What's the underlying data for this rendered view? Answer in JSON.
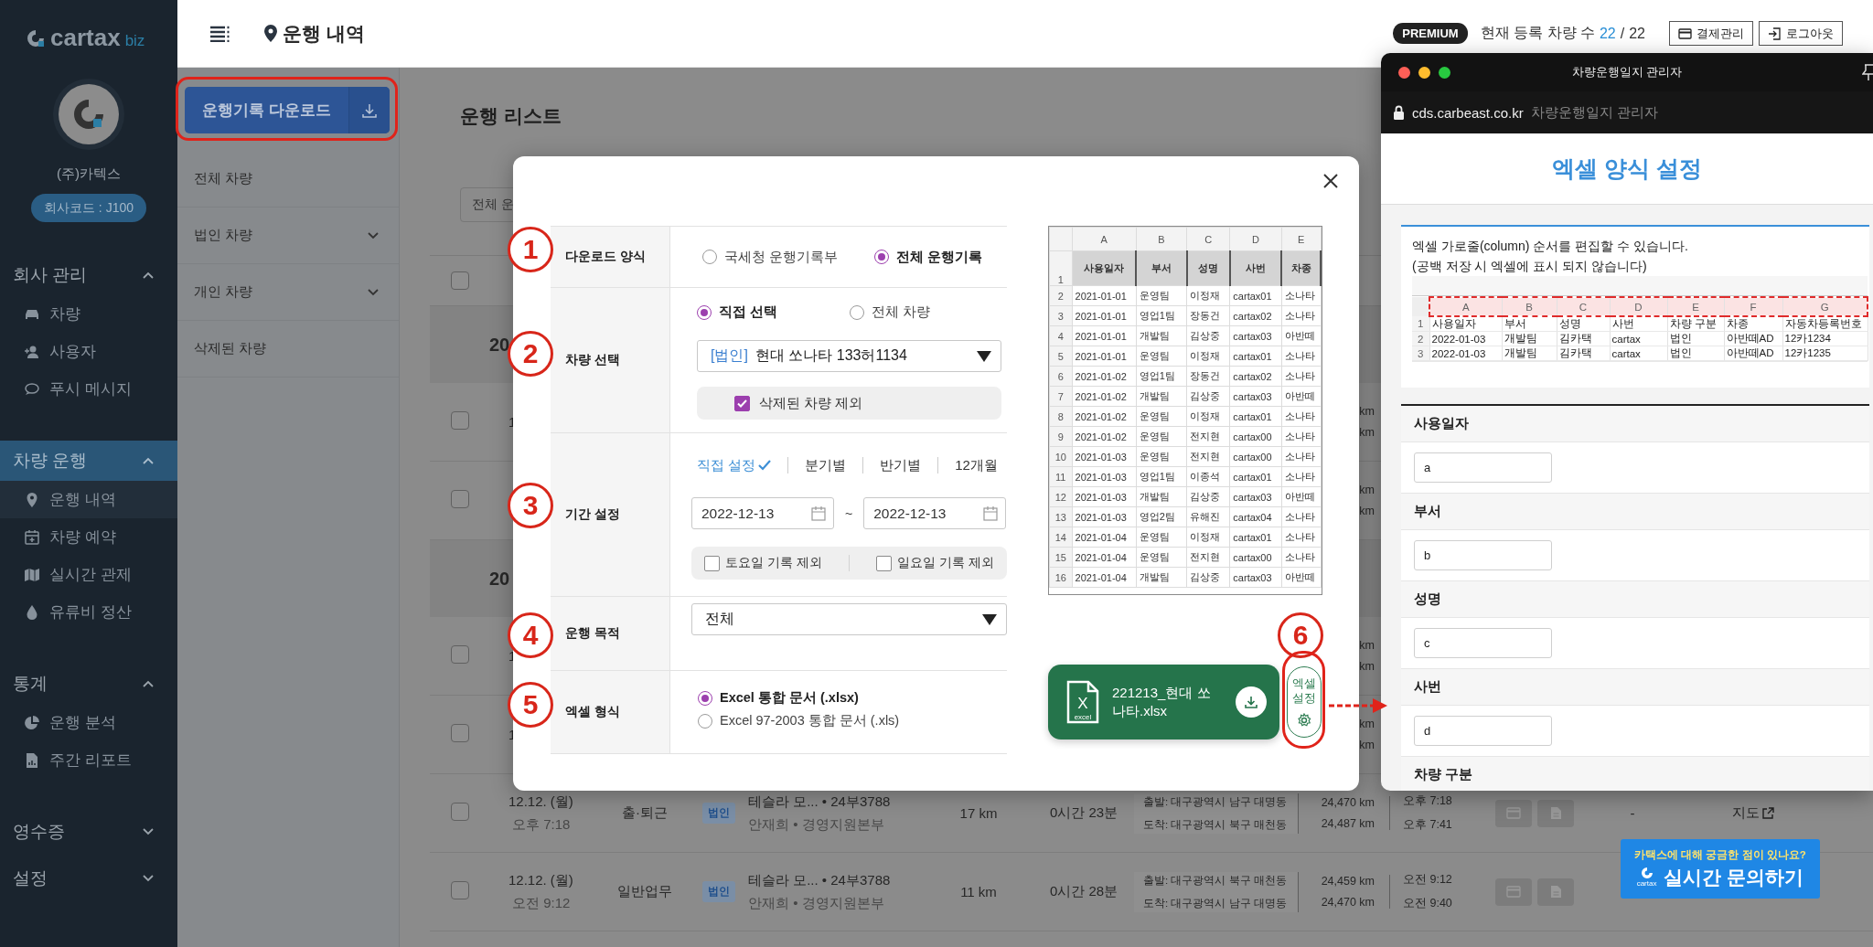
{
  "sidebar": {
    "logo": {
      "name": "cartax",
      "suffix": "biz"
    },
    "company": "(주)카텍스",
    "company_code": "회사코드 : J100",
    "sections": [
      {
        "title": "회사 관리",
        "expanded": true,
        "selected": false,
        "items": [
          {
            "label": "차량",
            "selected": false
          },
          {
            "label": "사용자",
            "selected": false
          },
          {
            "label": "푸시 메시지",
            "selected": false
          }
        ]
      },
      {
        "title": "차량 운행",
        "expanded": true,
        "selected": true,
        "items": [
          {
            "label": "운행 내역",
            "selected": true
          },
          {
            "label": "차량 예약",
            "selected": false
          },
          {
            "label": "실시간 관제",
            "selected": false
          },
          {
            "label": "유류비 정산",
            "selected": false
          }
        ]
      },
      {
        "title": "통계",
        "expanded": true,
        "selected": false,
        "items": [
          {
            "label": "운행 분석",
            "selected": false
          },
          {
            "label": "주간 리포트",
            "selected": false
          }
        ]
      },
      {
        "title": "영수증",
        "expanded": false,
        "selected": false
      },
      {
        "title": "설정",
        "expanded": false,
        "selected": false
      }
    ]
  },
  "top_bar": {
    "title": "운행 내역",
    "plan": "PREMIUM",
    "vehicle_count_label": "현재 등록 차량 수",
    "vehicle_count": "22",
    "vehicle_separator": "/",
    "vehicle_total": "22",
    "buttons": [
      "결제관리",
      "로그아웃"
    ]
  },
  "sub_sidebar": {
    "download_button": "운행기록 다운로드",
    "filters": [
      {
        "label": "전체 차량",
        "expandable": false
      },
      {
        "label": "법인 차량",
        "expandable": true
      },
      {
        "label": "개인 차량",
        "expandable": true
      },
      {
        "label": "삭제된 차량",
        "expandable": false
      }
    ]
  },
  "trip_list": {
    "title": "운행 리스트",
    "filter": "전체 운",
    "rows": [
      {
        "kind": "header",
        "checked": false
      },
      {
        "kind": "date_group",
        "label": "20"
      },
      {
        "kind": "trip",
        "checked": false,
        "date": "1",
        "odometer_start": "km",
        "odometer_end": "km"
      },
      {
        "kind": "trip",
        "checked": false,
        "odometer_start": "km",
        "odometer_end": "km"
      },
      {
        "kind": "date_group",
        "label": "20"
      },
      {
        "kind": "trip",
        "checked": false,
        "date": "1",
        "odometer_start": "km",
        "odometer_end": "km"
      },
      {
        "kind": "trip",
        "checked": false,
        "date": "1",
        "odometer_start": "km",
        "odometer_end": "km"
      },
      {
        "kind": "trip",
        "checked": false,
        "date": "12.12. (월)",
        "time": "오후 7:18",
        "purpose": "출·퇴근",
        "type": "법인",
        "vehicle": "테슬라 모... • 24부3788",
        "driver": "안재희 • 경영지원본부",
        "distance": "17 km",
        "duration": "0시간 23분",
        "departure": "출발: 대구광역시 남구 대명동",
        "arrival": "도착: 대구광역시 북구 매천동",
        "odometer_start": "24,470 km",
        "odometer_end": "24,487 km",
        "start_time": "오후 7:18",
        "end_time": "오후 7:41",
        "receipt": "-",
        "map": "지도"
      },
      {
        "kind": "trip",
        "checked": false,
        "date": "12.12. (월)",
        "time": "오전 9:12",
        "purpose": "일반업무",
        "type": "법인",
        "vehicle": "테슬라 모... • 24부3788",
        "driver": "안재희 • 경영지원본부",
        "distance": "11 km",
        "duration": "0시간 28분",
        "departure": "출발: 대구광역시 북구 매천동",
        "arrival": "도착: 대구광역시 남구 대명동",
        "odometer_start": "24,459 km",
        "odometer_end": "24,470 km",
        "start_time": "오전 9:12",
        "end_time": "오전 9:40"
      }
    ]
  },
  "modal": {
    "form": [
      {
        "kind": "radio_row",
        "label": "다운로드 양식",
        "options": [
          {
            "label": "국세청 운행기록부",
            "selected": false
          },
          {
            "label": "전체 운행기록",
            "selected": true
          }
        ]
      },
      {
        "kind": "vehicle",
        "label": "차량 선택",
        "options": [
          {
            "label": "직접 선택",
            "selected": true
          },
          {
            "label": "전체 차량",
            "selected": false
          }
        ],
        "select_tag": "[법인]",
        "select_value": "현대 쏘나타  133허1134",
        "exclude": {
          "label": "삭제된 차량 제외",
          "checked": true
        }
      },
      {
        "kind": "period",
        "label": "기간 설정",
        "tabs": [
          {
            "label": "직접 설정",
            "selected": true
          },
          {
            "label": "분기별",
            "selected": false
          },
          {
            "label": "반기별",
            "selected": false
          },
          {
            "label": "12개월",
            "selected": false
          }
        ],
        "start": "2022-12-13",
        "range_separator": "~",
        "end": "2022-12-13",
        "exclusions": [
          {
            "label": "토요일 기록 제외",
            "checked": false
          },
          {
            "label": "일요일 기록 제외",
            "checked": false
          }
        ]
      },
      {
        "kind": "select",
        "label": "운행 목적",
        "value": "전체"
      },
      {
        "kind": "radio_stack",
        "label": "엑셀 형식",
        "options": [
          {
            "label": "Excel 통합 문서 (.xlsx)",
            "selected": true
          },
          {
            "label": "Excel 97-2003 통합 문서 (.xls)",
            "selected": false
          }
        ]
      }
    ],
    "preview": {
      "column_letters": [
        "A",
        "B",
        "C",
        "D",
        "E"
      ],
      "header_row": "1",
      "headers": [
        "사용일자",
        "부서",
        "성명",
        "사번",
        "차종"
      ],
      "rows": [
        [
          "2",
          "2021-01-01",
          "운영팀",
          "이정재",
          "cartax01",
          "소나타"
        ],
        [
          "3",
          "2021-01-01",
          "영업1팀",
          "장동건",
          "cartax02",
          "소나타"
        ],
        [
          "4",
          "2021-01-01",
          "개발팀",
          "김상중",
          "cartax03",
          "아반떼"
        ],
        [
          "5",
          "2021-01-01",
          "운영팀",
          "이정재",
          "cartax01",
          "소나타"
        ],
        [
          "6",
          "2021-01-02",
          "영업1팀",
          "장동건",
          "cartax02",
          "소나타"
        ],
        [
          "7",
          "2021-01-02",
          "개발팀",
          "김상중",
          "cartax03",
          "아반떼"
        ],
        [
          "8",
          "2021-01-02",
          "운영팀",
          "이정재",
          "cartax01",
          "소나타"
        ],
        [
          "9",
          "2021-01-02",
          "운영팀",
          "전지현",
          "cartax00",
          "소나타"
        ],
        [
          "10",
          "2021-01-03",
          "운영팀",
          "전지현",
          "cartax00",
          "소나타"
        ],
        [
          "11",
          "2021-01-03",
          "영업1팀",
          "이종석",
          "cartax01",
          "소나타"
        ],
        [
          "12",
          "2021-01-03",
          "개발팀",
          "김상중",
          "cartax03",
          "아반떼"
        ],
        [
          "13",
          "2021-01-03",
          "영업2팀",
          "유해진",
          "cartax04",
          "소나타"
        ],
        [
          "14",
          "2021-01-04",
          "운영팀",
          "이정재",
          "cartax01",
          "소나타"
        ],
        [
          "15",
          "2021-01-04",
          "운영팀",
          "전지현",
          "cartax00",
          "소나타"
        ],
        [
          "16",
          "2021-01-04",
          "개발팀",
          "김상중",
          "cartax03",
          "아반떼"
        ]
      ]
    },
    "file": {
      "name": "221213_현대 쏘나타.xlsx",
      "icon_letter": "X",
      "icon_caption": "excel"
    },
    "excel_settings": "엑셀 설정"
  },
  "annotations": {
    "steps": [
      "1",
      "2",
      "3",
      "4",
      "5",
      "6"
    ]
  },
  "popup": {
    "title": "차량운행일지 관리자",
    "url_host": "cds.carbeast.co.kr",
    "url_title": "차량운행일지 관리자",
    "heading": "엑셀 양식 설정",
    "description": [
      "엑셀 가로줄(column) 순서를 편집할 수 있습니다.",
      "(공백 저장 시 엑셀에 표시 되지 않습니다)"
    ],
    "sheet": {
      "column_letters": [
        "A",
        "B",
        "C",
        "D",
        "E",
        "F",
        "G"
      ],
      "rows": [
        [
          "1",
          "사용일자",
          "부서",
          "성명",
          "사번",
          "차량 구분",
          "차종",
          "자동차등록번호"
        ],
        [
          "2",
          "2022-01-03",
          "개발팀",
          "김카택",
          "cartax",
          "법인",
          "아반떼AD",
          "12카1234"
        ],
        [
          "3",
          "2022-01-03",
          "개발팀",
          "김카택",
          "cartax",
          "법인",
          "아반떼AD",
          "12카1235"
        ]
      ]
    },
    "fields": [
      {
        "label": "사용일자",
        "value": "a"
      },
      {
        "label": "부서",
        "value": "b"
      },
      {
        "label": "성명",
        "value": "c"
      },
      {
        "label": "사번",
        "value": "d"
      },
      {
        "label": "차량 구분"
      }
    ]
  },
  "chat": {
    "question": "카택스에 대해 궁금한 점이 있나요?",
    "action": "실시간 문의하기",
    "logo_caption": "cartax"
  }
}
